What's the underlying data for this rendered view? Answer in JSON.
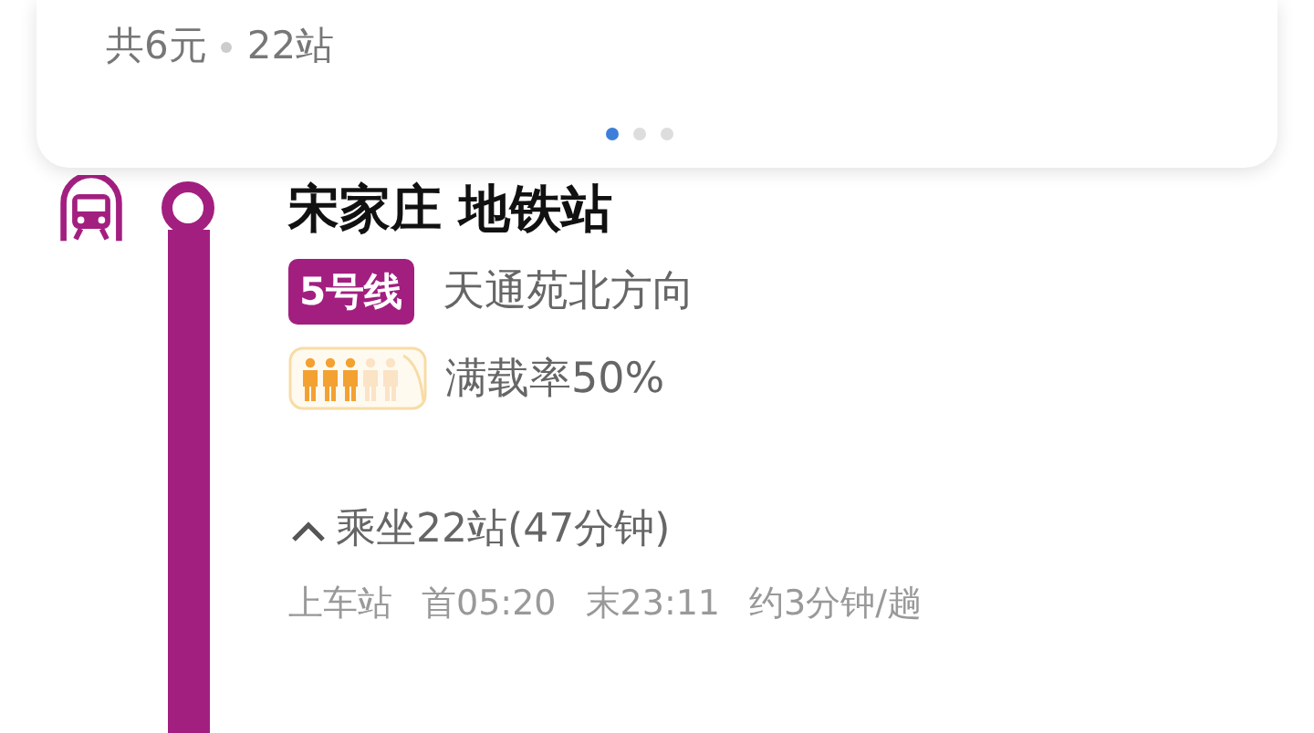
{
  "summary": {
    "fare": "共6元",
    "stops": "22站"
  },
  "pager": [
    {
      "selected": true
    },
    {
      "selected": false
    },
    {
      "selected": false
    }
  ],
  "station": {
    "name": "宋家庄 地铁站",
    "line": "5号线",
    "direction": "天通苑北方向"
  },
  "crowding": {
    "text": "满载率50%"
  },
  "ride": {
    "expanded": true,
    "text": "乘坐22站(47分钟)"
  },
  "info": [
    "上车站",
    "首05:20",
    "末23:11",
    "约3分钟/趟"
  ]
}
